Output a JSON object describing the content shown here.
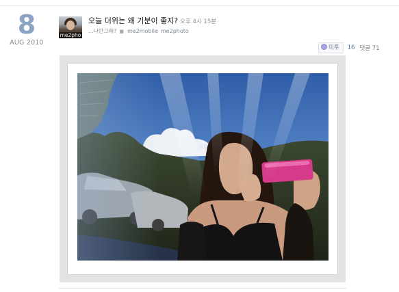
{
  "date": {
    "day": "8",
    "month_year": "AUG 2010"
  },
  "avatar": {
    "label": "me2pho"
  },
  "post": {
    "title": "오늘 더위는 왜 기분이 좋지?",
    "time": "오후 4시 15분",
    "meta_text": "...나만그래?",
    "app_tags": [
      "me2mobile",
      "me2photo"
    ]
  },
  "stats": {
    "metoo_label": "미투",
    "metoo_count": "16",
    "comment_label": "댓글 71"
  },
  "photo": {
    "subject": "selfie-reflection-in-car-window"
  },
  "colors": {
    "date_day": "#8ca4c4",
    "metoo_count": "#5272a8",
    "phone": "#d63a8a",
    "sky": "#4f7fc0"
  }
}
